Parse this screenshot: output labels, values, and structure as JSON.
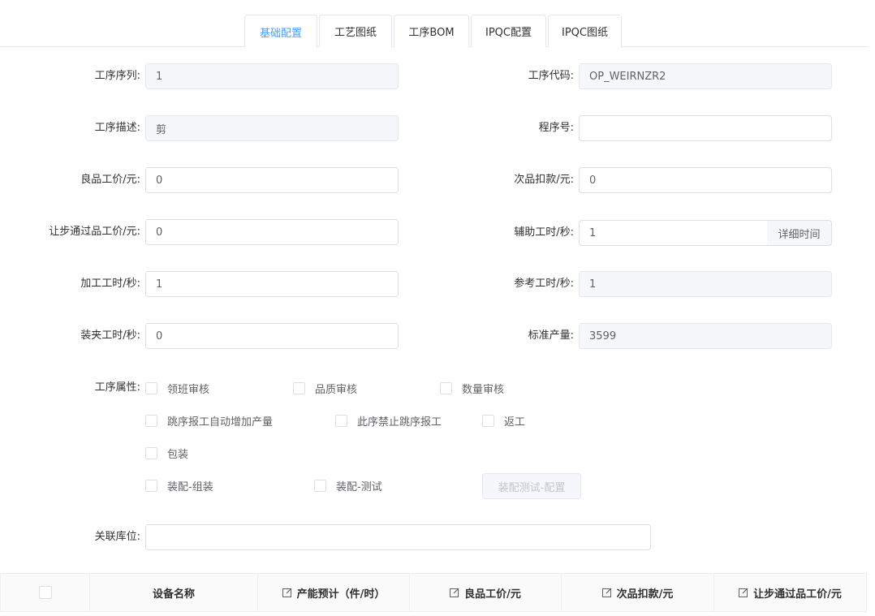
{
  "tabs": [
    {
      "label": "基础配置",
      "active": true
    },
    {
      "label": "工艺图纸",
      "active": false
    },
    {
      "label": "工序BOM",
      "active": false
    },
    {
      "label": "IPQC配置",
      "active": false
    },
    {
      "label": "IPQC图纸",
      "active": false
    }
  ],
  "form": {
    "process_seq": {
      "label": "工序序列:",
      "value": "1"
    },
    "process_code": {
      "label": "工序代码:",
      "value": "OP_WEIRNZR2"
    },
    "process_desc": {
      "label": "工序描述:",
      "value": "剪"
    },
    "program_no": {
      "label": "程序号:",
      "value": ""
    },
    "good_price": {
      "label": "良品工价/元:",
      "value": "0"
    },
    "defect_deduct": {
      "label": "次品扣款/元:",
      "value": "0"
    },
    "concession_price": {
      "label": "让步通过品工价/元:",
      "value": "0"
    },
    "aux_time": {
      "label": "辅助工时/秒:",
      "value": "1",
      "append_label": "详细时间"
    },
    "machining_time": {
      "label": "加工工时/秒:",
      "value": "1"
    },
    "ref_time": {
      "label": "参考工时/秒:",
      "value": "1"
    },
    "clamp_time": {
      "label": "装夹工时/秒:",
      "value": "0"
    },
    "std_output": {
      "label": "标准产量:",
      "value": "3599"
    },
    "attributes_label": "工序属性:",
    "attributes": {
      "leader_review": "领班审核",
      "quality_review": "品质审核",
      "qty_review": "数量审核",
      "auto_increase": "跳序报工自动增加产量",
      "forbid_skip": "此序禁止跳序报工",
      "rework": "返工",
      "packing": "包装",
      "assembly": "装配-组装",
      "testing": "装配-测试"
    },
    "assembly_test_config_button": "装配测试-配置",
    "location": {
      "label": "关联库位:",
      "value": ""
    }
  },
  "table": {
    "columns": [
      "设备名称",
      "产能预计（件/时）",
      "良品工价/元",
      "次品扣款/元",
      "让步通过品工价/元"
    ]
  },
  "icons": {
    "edit": "edit-icon"
  },
  "colors": {
    "accent": "#409eff",
    "border": "#dcdfe6",
    "disabled_bg": "#f5f7fa"
  }
}
